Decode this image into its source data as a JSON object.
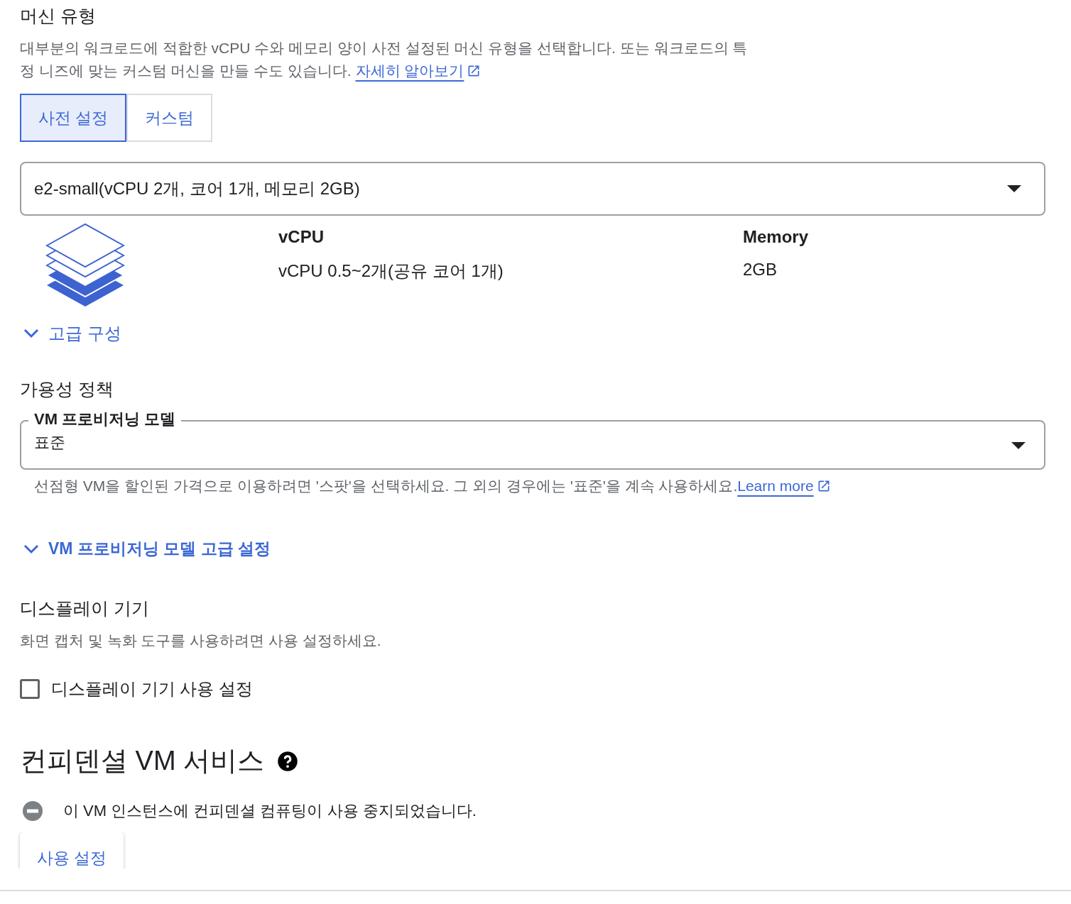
{
  "machine_type": {
    "title": "머신 유형",
    "description": "대부분의 워크로드에 적합한 vCPU 수와 메모리 양이 사전 설정된 머신 유형을 선택합니다. 또는 워크로드의 특정 니즈에 맞는 커스텀 머신을 만들 수도 있습니다.",
    "learn_more": "자세히 알아보기",
    "tabs": [
      {
        "label": "사전 설정",
        "selected": true
      },
      {
        "label": "커스텀",
        "selected": false
      }
    ],
    "select": {
      "value": "e2-small(vCPU 2개, 코어 1개, 메모리 2GB)"
    },
    "specs": [
      {
        "heading": "vCPU",
        "value": "vCPU 0.5~2개(공유 코어 1개)"
      },
      {
        "heading": "Memory",
        "value": "2GB"
      }
    ],
    "advanced": {
      "label": "고급 구성",
      "expanded": false
    }
  },
  "availability": {
    "title": "가용성 정책",
    "field": {
      "label": "VM 프로비저닝 모델",
      "value": "표준"
    },
    "helper": "선점형 VM을 할인된 가격으로 이용하려면 '스팟'을 선택하세요. 그 외의 경우에는 '표준'을 계속 사용하세요.",
    "learn_more": "Learn more",
    "advanced": {
      "label": "VM 프로비저닝 모델 고급 설정",
      "expanded": false
    }
  },
  "display": {
    "title": "디스플레이 기기",
    "description": "화면 캡처 및 녹화 도구를 사용하려면 사용 설정하세요.",
    "checkbox": {
      "label": "디스플레이 기기 사용 설정",
      "checked": false
    }
  },
  "confidential": {
    "title": "컨피덴셜 VM 서비스",
    "status": "이 VM 인스턴스에 컨피덴셜 컴퓨팅이 사용 중지되었습니다.",
    "button": "사용 설정"
  }
}
